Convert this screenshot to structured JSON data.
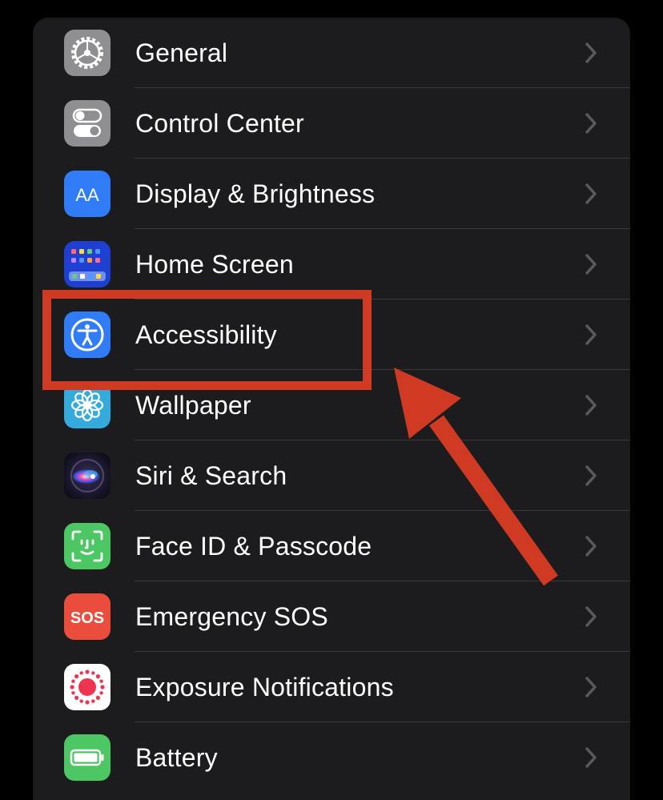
{
  "settings": {
    "items": [
      {
        "label": "General",
        "icon": "gear-icon",
        "icon_color": "#8e8e93"
      },
      {
        "label": "Control Center",
        "icon": "toggles-icon",
        "icon_color": "#8e8e93"
      },
      {
        "label": "Display & Brightness",
        "icon": "text-size-icon",
        "icon_color": "#2f7cf6"
      },
      {
        "label": "Home Screen",
        "icon": "app-grid-icon",
        "icon_color": "#1f3fd0"
      },
      {
        "label": "Accessibility",
        "icon": "accessibility-icon",
        "icon_color": "#2f7cf6"
      },
      {
        "label": "Wallpaper",
        "icon": "flower-icon",
        "icon_color": "#35aadc"
      },
      {
        "label": "Siri & Search",
        "icon": "siri-icon",
        "icon_color": "#1a1a2e"
      },
      {
        "label": "Face ID & Passcode",
        "icon": "face-id-icon",
        "icon_color": "#4cc763"
      },
      {
        "label": "Emergency SOS",
        "icon": "sos-icon",
        "icon_color": "#eb4d3d"
      },
      {
        "label": "Exposure Notifications",
        "icon": "exposure-icon",
        "icon_color": "#ffffff"
      },
      {
        "label": "Battery",
        "icon": "battery-icon",
        "icon_color": "#4cc763"
      }
    ],
    "icon_texts": {
      "display": "AA",
      "sos": "SOS"
    }
  },
  "annotation": {
    "highlight_color": "#d03a22",
    "highlighted_item": "Accessibility"
  }
}
